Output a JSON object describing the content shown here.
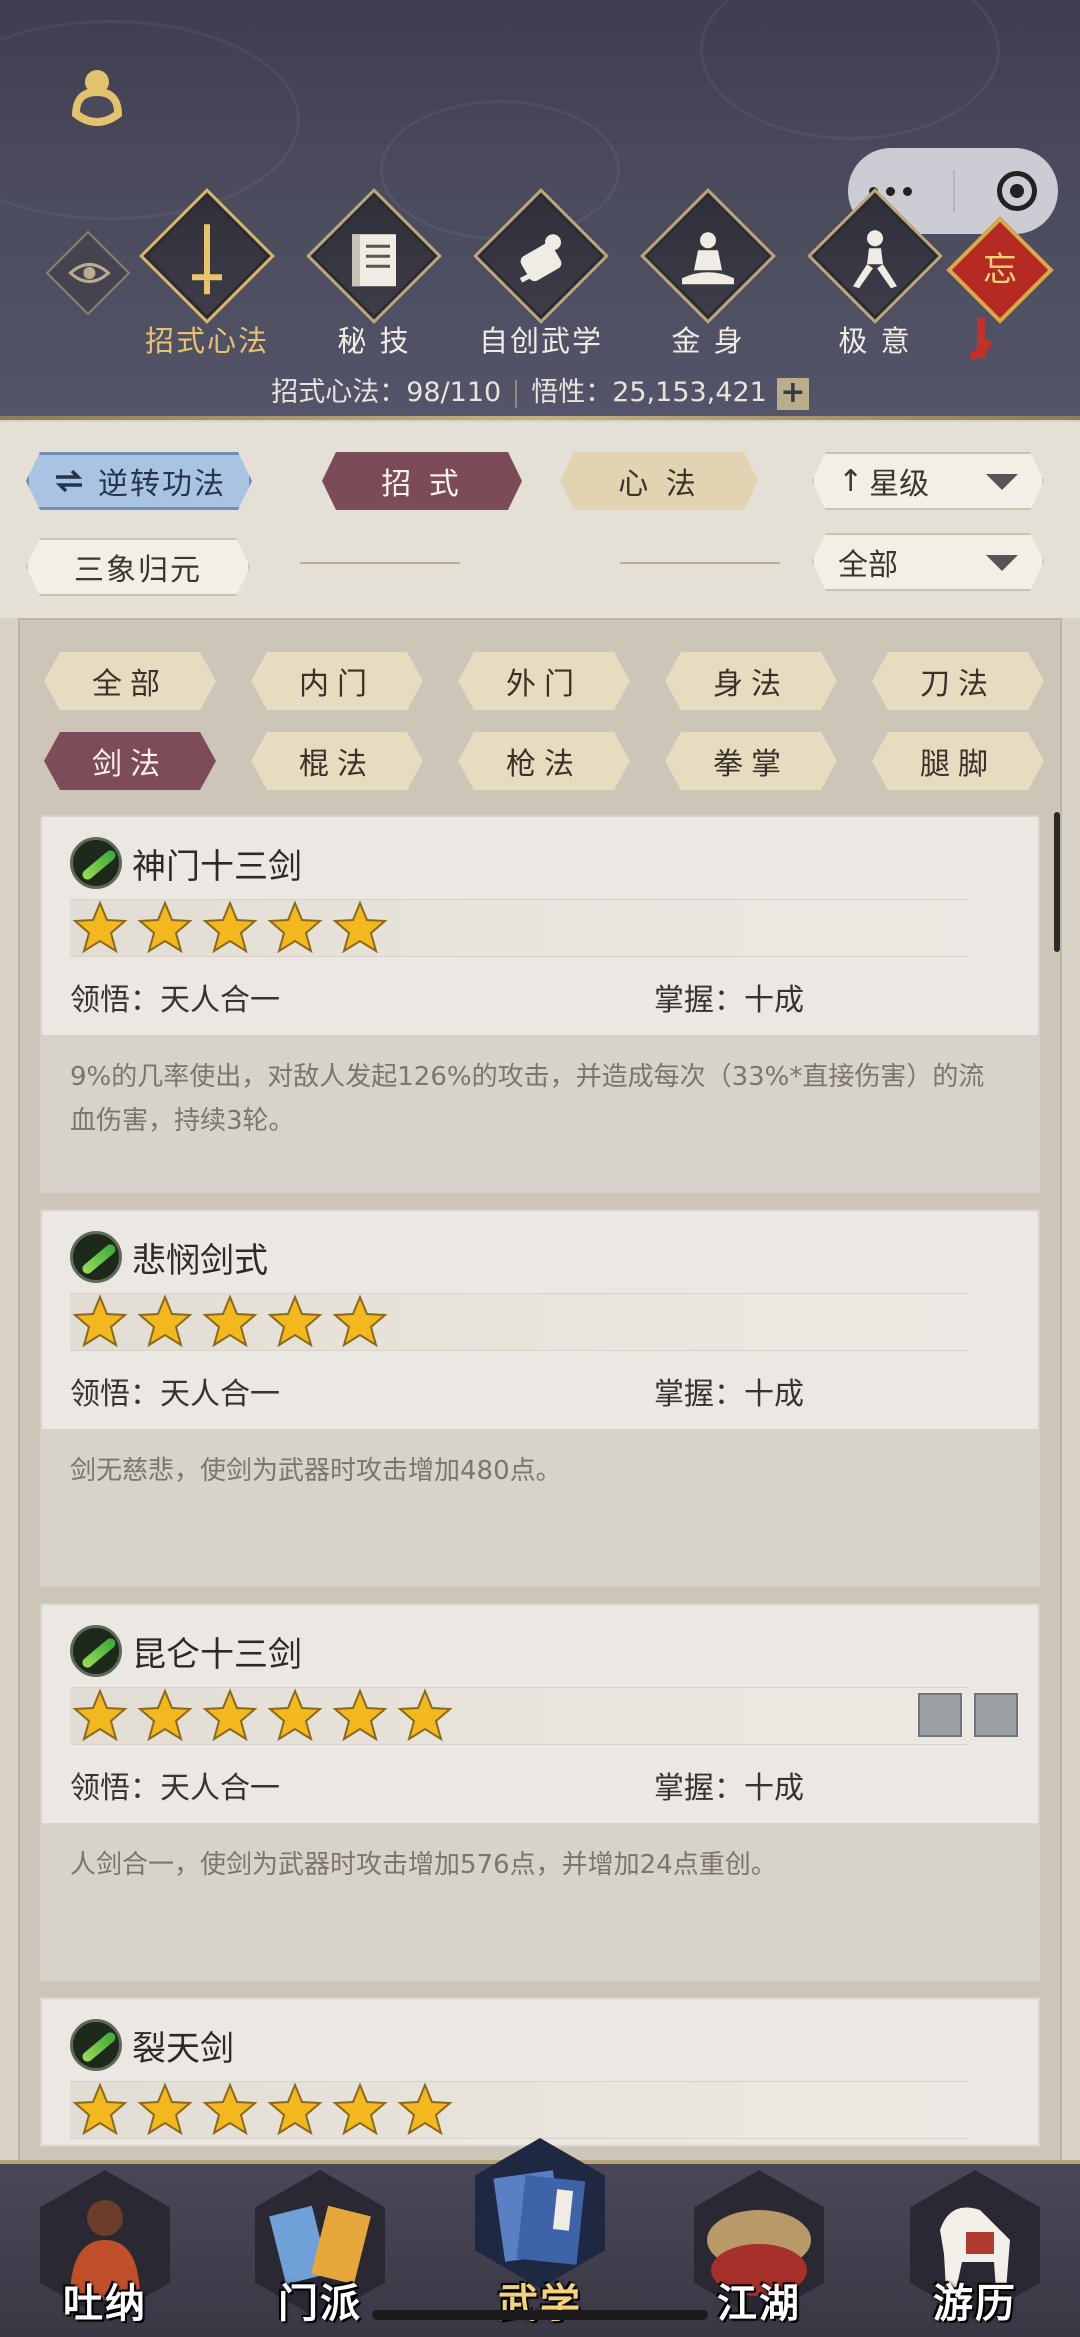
{
  "header": {
    "nav": [
      {
        "label": "招式心法",
        "icon": "sword-icon",
        "active": true
      },
      {
        "label": "秘 技",
        "icon": "book-icon",
        "active": false
      },
      {
        "label": "自创武学",
        "icon": "scroll-icon",
        "active": false
      },
      {
        "label": "金 身",
        "icon": "meditation-icon",
        "active": false
      },
      {
        "label": "极 意",
        "icon": "stance-icon",
        "active": false
      }
    ],
    "knot_char": "忘",
    "stat_label_1": "招式心法：",
    "stat_value_1": "98/110",
    "stat_label_2": "悟性：",
    "stat_value_2": "25,153,421",
    "plus": "+"
  },
  "filters": {
    "reverse": "逆转功法",
    "tab_zhaoshi": "招 式",
    "tab_xinfa": "心 法",
    "sort": "星级",
    "sort_arrow": "↑",
    "sanxiang": "三象归元",
    "range": "全部"
  },
  "categories": [
    "全部",
    "内门",
    "外门",
    "身法",
    "刀法",
    "剑法",
    "棍法",
    "枪法",
    "拳掌",
    "腿脚"
  ],
  "active_category": "剑法",
  "skills": [
    {
      "name": "神门十三剑",
      "stars": 5,
      "lingwu_label": "领悟：",
      "lingwu": "天人合一",
      "zhangwo_label": "掌握：",
      "zhangwo": "十成",
      "desc": "9%的几率使出，对敌人发起126%的攻击，并造成每次（33%*直接伤害）的流血伤害，持续3轮。"
    },
    {
      "name": "悲悯剑式",
      "stars": 5,
      "lingwu_label": "领悟：",
      "lingwu": "天人合一",
      "zhangwo_label": "掌握：",
      "zhangwo": "十成",
      "desc": "剑无慈悲，使剑为武器时攻击增加480点。"
    },
    {
      "name": "昆仑十三剑",
      "stars": 6,
      "lingwu_label": "领悟：",
      "lingwu": "天人合一",
      "zhangwo_label": "掌握：",
      "zhangwo": "十成",
      "desc": "人剑合一，使剑为武器时攻击增加576点，并增加24点重创。"
    },
    {
      "name": "裂天剑",
      "stars": 6
    }
  ],
  "bottom_nav": [
    {
      "label": "吐纳",
      "active": false
    },
    {
      "label": "门派",
      "active": false
    },
    {
      "label": "武学",
      "active": true
    },
    {
      "label": "江湖",
      "active": false
    },
    {
      "label": "游历",
      "active": false
    }
  ],
  "colors": {
    "accent_gold": "#e8c36a",
    "maroon": "#7b4c57",
    "header_bg": "#3d3d4f",
    "star": "#f2b81e"
  }
}
